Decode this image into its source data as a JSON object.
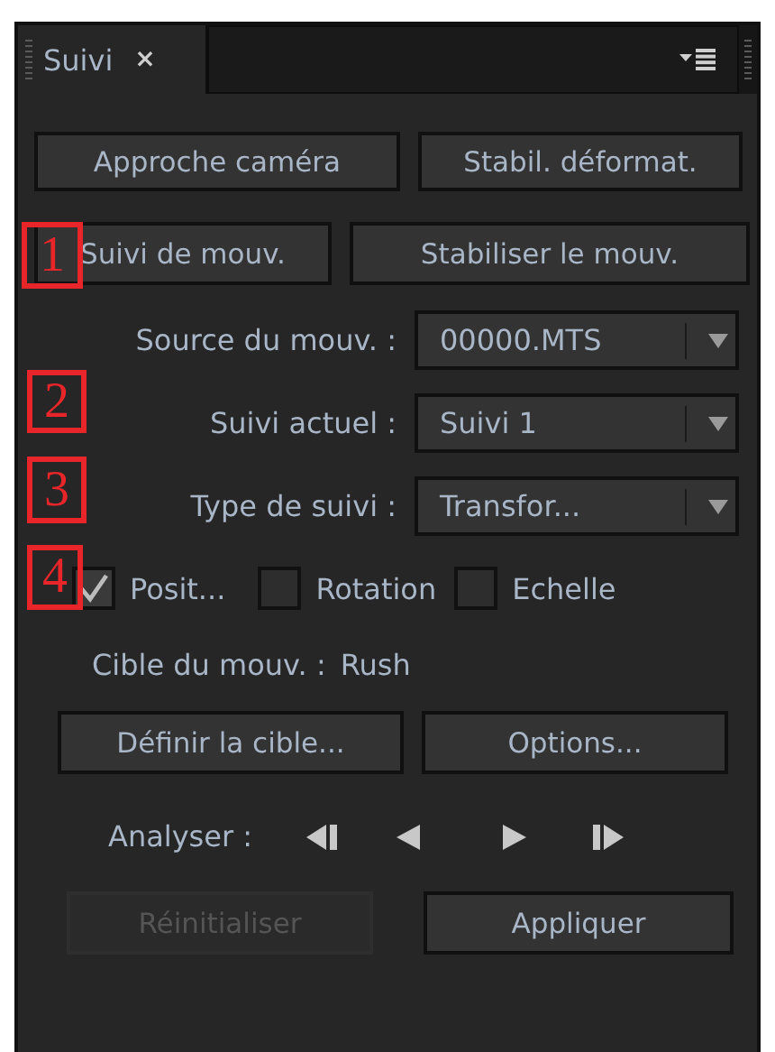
{
  "tab": {
    "label": "Suivi",
    "close": "×",
    "selected": true
  },
  "top_buttons": [
    {
      "label": "Approche caméra"
    },
    {
      "label": "Stabil. déformat."
    },
    {
      "label": "Suivi de mouv."
    },
    {
      "label": "Stabiliser le mouv."
    }
  ],
  "fields": [
    {
      "label": "Source du mouv. :",
      "value": "00000.MTS"
    },
    {
      "label": "Suivi actuel :",
      "value": "Suivi 1"
    },
    {
      "label": "Type de suivi :",
      "value": "Transfor..."
    }
  ],
  "checkboxes": [
    {
      "label": "Posit...",
      "checked": true
    },
    {
      "label": "Rotation",
      "checked": false
    },
    {
      "label": "Echelle",
      "checked": false
    }
  ],
  "target": {
    "label": "Cible du mouv. :",
    "value": "Rush"
  },
  "target_buttons": [
    {
      "label": "Définir la cible..."
    },
    {
      "label": "Options..."
    }
  ],
  "analyze": {
    "label": "Analyser :"
  },
  "bottom_buttons": [
    {
      "label": "Réinitialiser",
      "disabled": true
    },
    {
      "label": "Appliquer",
      "disabled": false
    }
  ],
  "markers": [
    "1",
    "2",
    "3",
    "4"
  ]
}
